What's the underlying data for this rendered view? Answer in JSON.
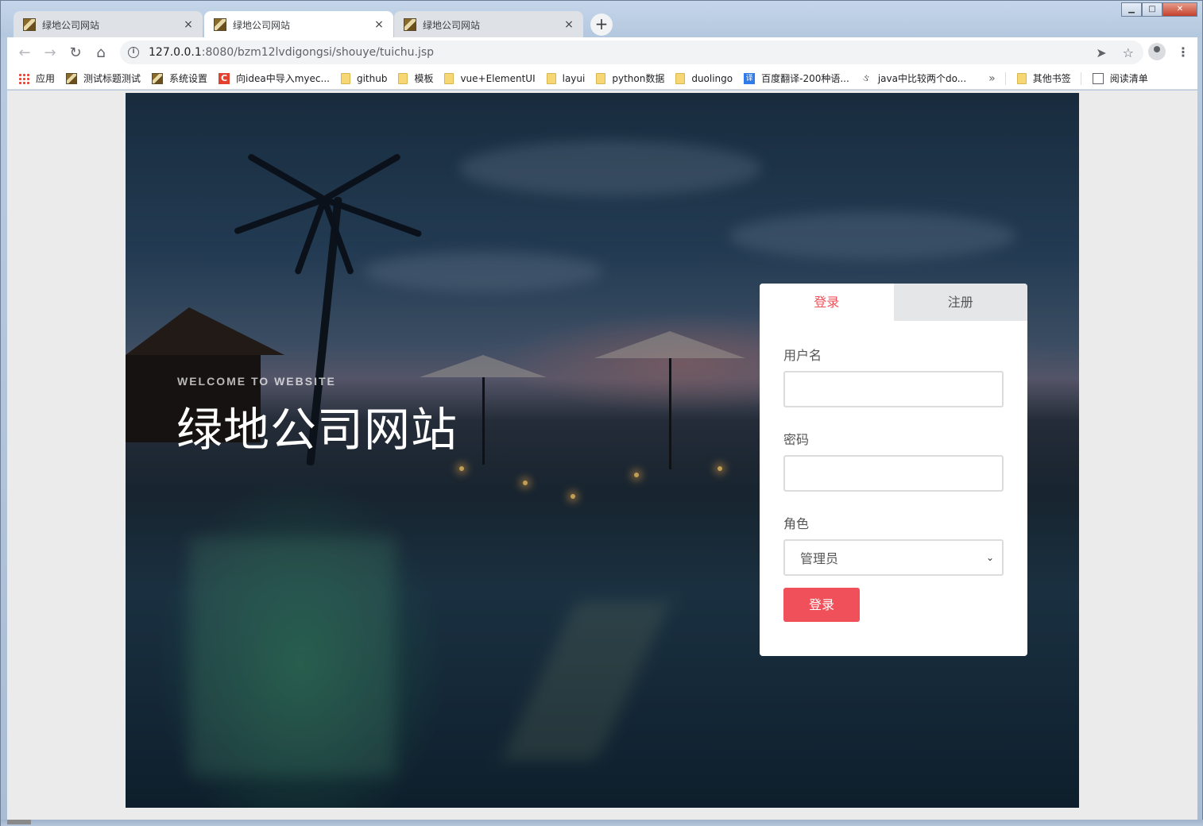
{
  "browser": {
    "tabs": [
      {
        "title": "绿地公司网站",
        "active": false
      },
      {
        "title": "绿地公司网站",
        "active": true
      },
      {
        "title": "绿地公司网站",
        "active": false
      }
    ],
    "new_tab_label": "+",
    "close_glyph": "×",
    "url_host": "127.0.0.1",
    "url_rest": ":8080/bzm12lvdigongsi/shouye/tuichu.jsp",
    "info_glyph": "i",
    "window_buttons": {
      "minimize": "▁",
      "maximize": "□",
      "close": "✕"
    },
    "nav_icons": {
      "back": "←",
      "forward": "→",
      "reload": "↻",
      "home": "⌂"
    },
    "omnibox_icons": {
      "send": "➤",
      "star": "☆"
    },
    "kebab": "⋮",
    "bookmarks": [
      {
        "label": "应用",
        "icon": "apps-icon"
      },
      {
        "label": "测试标题测试",
        "icon": "page-icon"
      },
      {
        "label": "系统设置",
        "icon": "page-icon"
      },
      {
        "label": "向idea中导入myec...",
        "icon": "c-icon"
      },
      {
        "label": "github",
        "icon": "folder-icon"
      },
      {
        "label": "模板",
        "icon": "folder-icon"
      },
      {
        "label": "vue+ElementUI",
        "icon": "folder-icon"
      },
      {
        "label": "layui",
        "icon": "folder-icon"
      },
      {
        "label": "python数据",
        "icon": "folder-icon"
      },
      {
        "label": "duolingo",
        "icon": "folder-icon"
      },
      {
        "label": "百度翻译-200种语...",
        "icon": "translate-icon"
      },
      {
        "label": "java中比较两个do...",
        "icon": "symbol-icon"
      }
    ],
    "bookmarks_more": "»",
    "other_bookmarks": "其他书签",
    "reading_list": "阅读清单",
    "c_glyph": "C",
    "translate_glyph": "译",
    "symbol_glyph": "ઙ"
  },
  "hero": {
    "welcome": "WELCOME TO WEBSITE",
    "title": "绿地公司网站"
  },
  "login": {
    "tab_login": "登录",
    "tab_register": "注册",
    "username_label": "用户名",
    "username_value": "",
    "password_label": "密码",
    "password_value": "",
    "role_label": "角色",
    "role_selected": "管理员",
    "role_chevron": "⌄",
    "submit_label": "登录",
    "accent_color": "#f0505a"
  }
}
